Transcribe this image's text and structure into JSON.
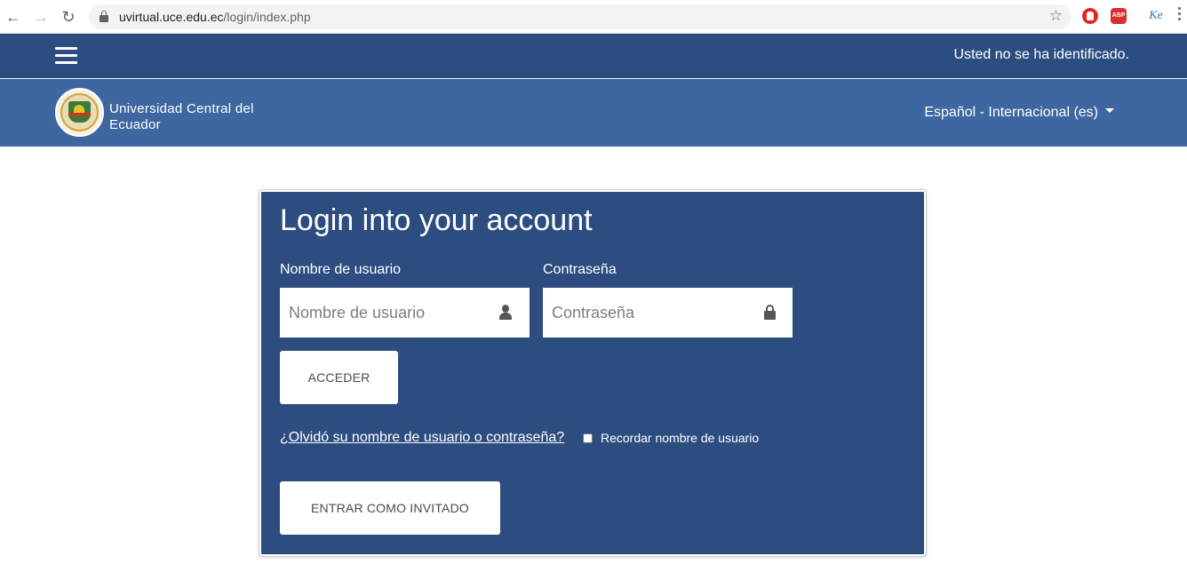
{
  "browser": {
    "url_host": "uvirtual.uce.edu.ec",
    "url_path": "/login/index.php",
    "extension_abp_label": "ABP",
    "extension_icon3_label": "Ke"
  },
  "topbar": {
    "identification_status": "Usted no se ha identificado."
  },
  "header": {
    "site_name": "Universidad Central del Ecuador",
    "language": "Español - Internacional (es)"
  },
  "login": {
    "title": "Login into your account",
    "username_label": "Nombre de usuario",
    "username_placeholder": "Nombre de usuario",
    "password_label": "Contraseña",
    "password_placeholder": "Contraseña",
    "login_button": "ACCEDER",
    "forgot_link": "¿Olvidó su nombre de usuario o contraseña?",
    "remember_label": "Recordar nombre de usuario",
    "remember_checked": false,
    "guest_button": "ENTRAR COMO INVITADO"
  },
  "colors": {
    "topbar_bg": "#2d4d80",
    "header_bg": "#3e66a0",
    "card_bg": "#2d4d80"
  }
}
